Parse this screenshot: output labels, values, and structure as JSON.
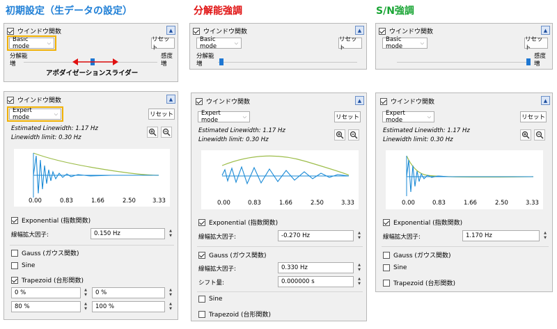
{
  "headings": [
    "初期設定（生データの設定）",
    "分解能強調",
    "S/N強調"
  ],
  "heading_colors": [
    "#1f7fd6",
    "#e01010",
    "#1aa535"
  ],
  "accent": "#f0b000",
  "icons": {
    "collapse": "triangle-up-icon",
    "zoom_in": "zoom-in-icon",
    "zoom_out": "zoom-out-icon",
    "check": "checkmark-icon"
  },
  "common": {
    "window_func": "ウインドウ関数",
    "reset": "リセット",
    "res_label": "分解能",
    "incr": "増",
    "sens_label": "感度",
    "est": "Estimated Linewidth: 1.17 Hz",
    "limit": "Linewidth limit: 0.30 Hz",
    "exponential": "Exponential (指数関数)",
    "gauss": "Gauss (ガウス関数)",
    "sine": "Sine",
    "trapezoid": "Trapezoid (台形関数)",
    "broadening": "線幅拡大因子:",
    "shift": "シフト量:",
    "ticks": [
      "0.00",
      "0.83",
      "1.66",
      "2.50",
      "3.33"
    ]
  },
  "basic": [
    {
      "mode": "Basic mode",
      "slider": 0.5
    },
    {
      "mode": "Basic mode",
      "slider": 0.0
    },
    {
      "mode": "Basic mode",
      "slider": 1.0
    }
  ],
  "apod_slider_label": "アポダイゼーションスライダー",
  "expert": [
    {
      "mode": "Expert mode",
      "exp_on": true,
      "exp_val": "0.150 Hz",
      "gauss_on": false,
      "sine_on": false,
      "trap_on": true,
      "trap": [
        "0 %",
        "0 %",
        "80 %",
        "100 %"
      ]
    },
    {
      "mode": "Expert mode",
      "exp_on": true,
      "exp_val": "-0.270 Hz",
      "gauss_on": true,
      "gauss_val": "0.330 Hz",
      "shift_val": "0.000000 s",
      "sine_on": false,
      "trap_on": false
    },
    {
      "mode": "Expert mode",
      "exp_on": true,
      "exp_val": "1.170 Hz",
      "gauss_on": false,
      "sine_on": false,
      "trap_on": false
    }
  ]
}
